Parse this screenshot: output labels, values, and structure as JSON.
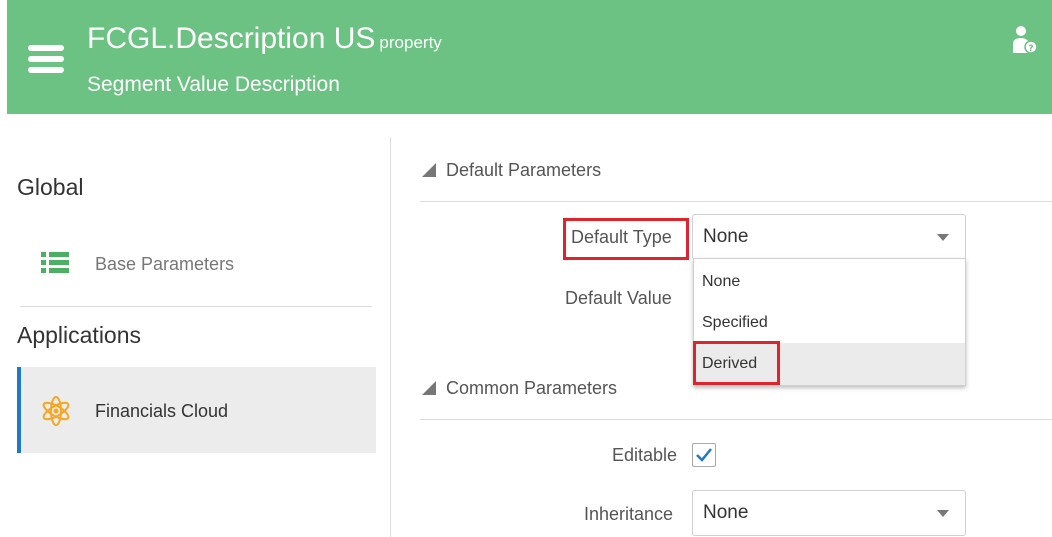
{
  "header": {
    "title": "FCGL.Description US",
    "type_label": "property",
    "subtitle": "Segment Value Description",
    "menu_icon": "list-icon",
    "user_icon": "user-help-icon",
    "background_color": "#6cc282"
  },
  "sidebar": {
    "global_heading": "Global",
    "global_items": [
      {
        "label": "Base Parameters",
        "icon": "list-icon"
      }
    ],
    "applications_heading": "Applications",
    "application_items": [
      {
        "label": "Financials Cloud",
        "icon": "flower-icon",
        "selected": true
      }
    ]
  },
  "default_parameters": {
    "title": "Default Parameters",
    "default_type_label": "Default Type",
    "default_type_value": "None",
    "default_value_label": "Default Value",
    "dropdown_options": [
      {
        "label": "None"
      },
      {
        "label": "Specified"
      },
      {
        "label": "Derived",
        "highlighted": true
      }
    ]
  },
  "common_parameters": {
    "title": "Common Parameters",
    "editable_label": "Editable",
    "editable_checked": true,
    "inheritance_label": "Inheritance",
    "inheritance_value": "None"
  },
  "annotation_color": "#e0242c",
  "accent_color": "#1e7ac8"
}
